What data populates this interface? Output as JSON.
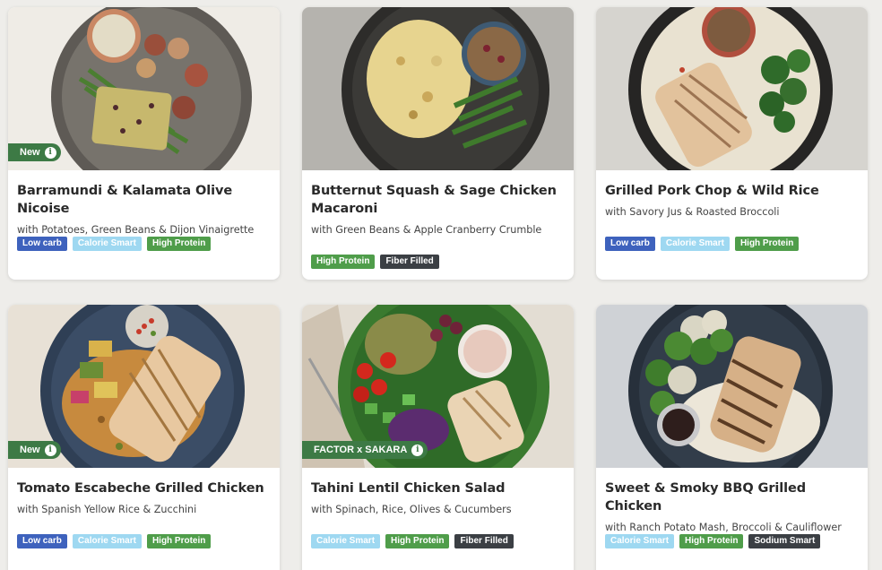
{
  "meals": [
    {
      "title": "Barramundi & Kalamata Olive Nicoise",
      "subtitle": "with Potatoes, Green Beans & Dijon Vinaigrette",
      "badge": "New",
      "tags": [
        {
          "label": "Low carb",
          "kind": "lowcarb"
        },
        {
          "label": "Calorie Smart",
          "kind": "calorie"
        },
        {
          "label": "High Protein",
          "kind": "protein"
        }
      ]
    },
    {
      "title": "Butternut Squash & Sage Chicken Macaroni",
      "subtitle": "with Green Beans & Apple Cranberry Crumble",
      "badge": "",
      "tags": [
        {
          "label": "High Protein",
          "kind": "protein"
        },
        {
          "label": "Fiber Filled",
          "kind": "fiber"
        }
      ]
    },
    {
      "title": "Grilled Pork Chop & Wild Rice",
      "subtitle": "with Savory Jus & Roasted Broccoli",
      "badge": "",
      "tags": [
        {
          "label": "Low carb",
          "kind": "lowcarb"
        },
        {
          "label": "Calorie Smart",
          "kind": "calorie"
        },
        {
          "label": "High Protein",
          "kind": "protein"
        }
      ]
    },
    {
      "title": "Tomato Escabeche Grilled Chicken",
      "subtitle": "with Spanish Yellow Rice & Zucchini",
      "badge": "New",
      "tags": [
        {
          "label": "Low carb",
          "kind": "lowcarb"
        },
        {
          "label": "Calorie Smart",
          "kind": "calorie"
        },
        {
          "label": "High Protein",
          "kind": "protein"
        }
      ]
    },
    {
      "title": "Tahini Lentil Chicken Salad",
      "subtitle": "with Spinach, Rice, Olives & Cucumbers",
      "badge": "FACTOR x SAKARA",
      "tags": [
        {
          "label": "Calorie Smart",
          "kind": "calorie"
        },
        {
          "label": "High Protein",
          "kind": "protein"
        },
        {
          "label": "Fiber Filled",
          "kind": "fiber"
        }
      ]
    },
    {
      "title": "Sweet & Smoky BBQ Grilled Chicken",
      "subtitle": "with Ranch Potato Mash, Broccoli & Cauliflower",
      "badge": "",
      "tags": [
        {
          "label": "Calorie Smart",
          "kind": "calorie"
        },
        {
          "label": "High Protein",
          "kind": "protein"
        },
        {
          "label": "Sodium Smart",
          "kind": "sodium"
        }
      ]
    }
  ],
  "colors": {
    "low_carb": "#3e62bd",
    "calorie_smart": "#9ed8f1",
    "high_protein": "#4f9d4a",
    "fiber_filled": "#3b3f44",
    "sodium_smart": "#3b3f44",
    "badge": "#3d7a45"
  }
}
